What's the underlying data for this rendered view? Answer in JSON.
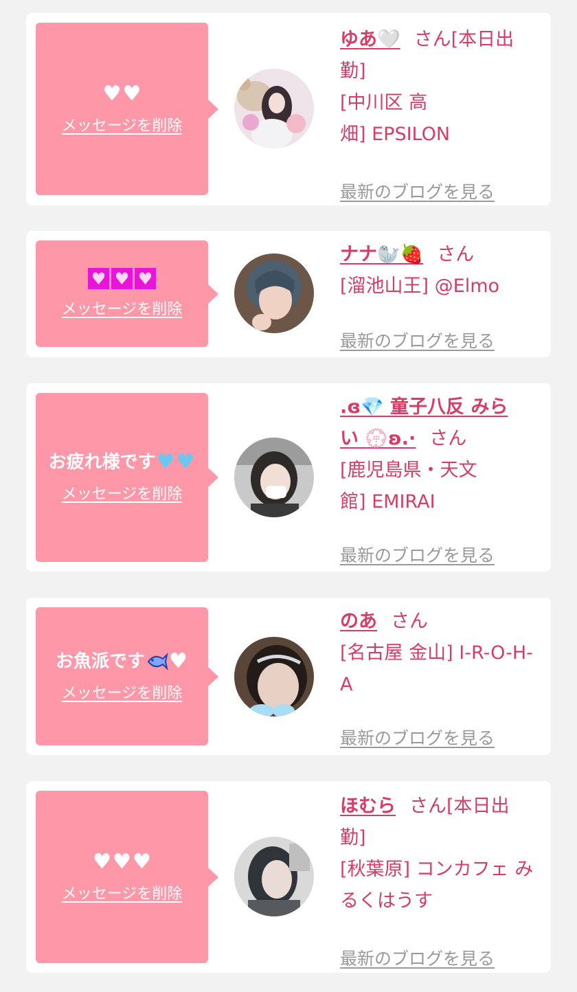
{
  "common": {
    "delete_label": "メッセージを削除",
    "blog_label": "最新のブログを見る",
    "san_label": "さん",
    "working_today_label": "[本日出勤]"
  },
  "colors": {
    "bubble": "#fe97a8",
    "name": "#d63c64",
    "link_gray": "#999999",
    "card_bg": "#ffffff",
    "page_bg": "#f2f2f2"
  },
  "cards": [
    {
      "message": "🤍🤍",
      "message_icons": [
        "white-heart",
        "white-heart"
      ],
      "name": "ゆあ🤍",
      "store_line1": "[中川区 高",
      "store_line2": "畑] EPSILON",
      "working_today": true
    },
    {
      "message": "💟💟💟",
      "message_icons": [
        "heart-decoration",
        "heart-decoration",
        "heart-decoration"
      ],
      "name": "ナナ🦭🍓",
      "store_line1": "[溜池山王] @Elmo",
      "working_today": false
    },
    {
      "message": "お疲れ様です💙💙",
      "message_text": "お疲れ様です",
      "message_icons": [
        "blue-heart",
        "blue-heart"
      ],
      "name_line1": ".ɞ💎 童子八反 みら",
      "name_line2": "い 💮ʚ.·",
      "store_line1": "[鹿児島県・天文",
      "store_line2": "館] EMIRAI",
      "working_today": false
    },
    {
      "message": "お魚派です🐟🤍",
      "message_text": "お魚派です",
      "message_icons": [
        "fish",
        "white-heart"
      ],
      "name": "のあ",
      "store_line1": "[名古屋 金山] I-R-O-H-",
      "store_line2": "A",
      "working_today": false
    },
    {
      "message": "🤍🤍🤍",
      "message_icons": [
        "white-heart",
        "white-heart",
        "white-heart"
      ],
      "name": "ほむら",
      "store_line1": "[秋葉原] コンカフェ み",
      "store_line2": "るくはうす",
      "working_today": true
    }
  ]
}
